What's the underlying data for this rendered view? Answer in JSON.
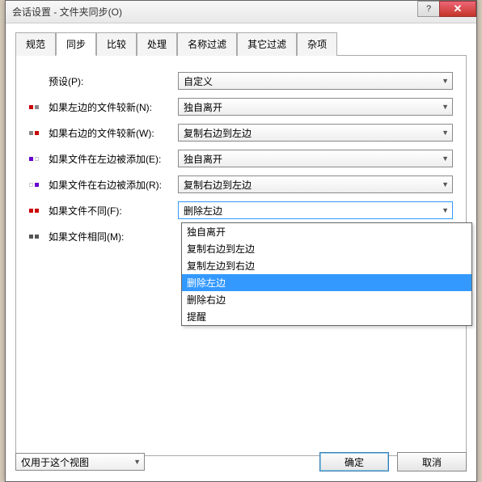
{
  "title": "会话设置 - 文件夹同步(O)",
  "tabs": [
    "规范",
    "同步",
    "比较",
    "处理",
    "名称过滤",
    "其它过滤",
    "杂项"
  ],
  "activeTab": 1,
  "rows": {
    "preset": {
      "label": "预设(P):",
      "value": "自定义"
    },
    "leftNewer": {
      "label": "如果左边的文件较新(N):",
      "value": "独自离开",
      "colors": [
        "#c00",
        "#888"
      ]
    },
    "rightNewer": {
      "label": "如果右边的文件较新(W):",
      "value": "复制右边到左边",
      "colors": [
        "#888",
        "#c00"
      ]
    },
    "leftAdded": {
      "label": "如果文件在左边被添加(E):",
      "value": "独自离开",
      "colors": [
        "#60c",
        "#fff"
      ]
    },
    "rightAdded": {
      "label": "如果文件在右边被添加(R):",
      "value": "复制右边到左边",
      "colors": [
        "#fff",
        "#60c"
      ]
    },
    "different": {
      "label": "如果文件不同(F):",
      "value": "删除左边",
      "colors": [
        "#c00",
        "#c00"
      ]
    },
    "same": {
      "label": "如果文件相同(M):",
      "value": "",
      "colors": [
        "#555",
        "#555"
      ]
    }
  },
  "dropdownOptions": [
    "独自离开",
    "复制右边到左边",
    "复制左边到右边",
    "删除左边",
    "删除右边",
    "提醒"
  ],
  "dropdownSelected": 3,
  "footer": {
    "scope": "仅用于这个视图",
    "ok": "确定",
    "cancel": "取消"
  }
}
